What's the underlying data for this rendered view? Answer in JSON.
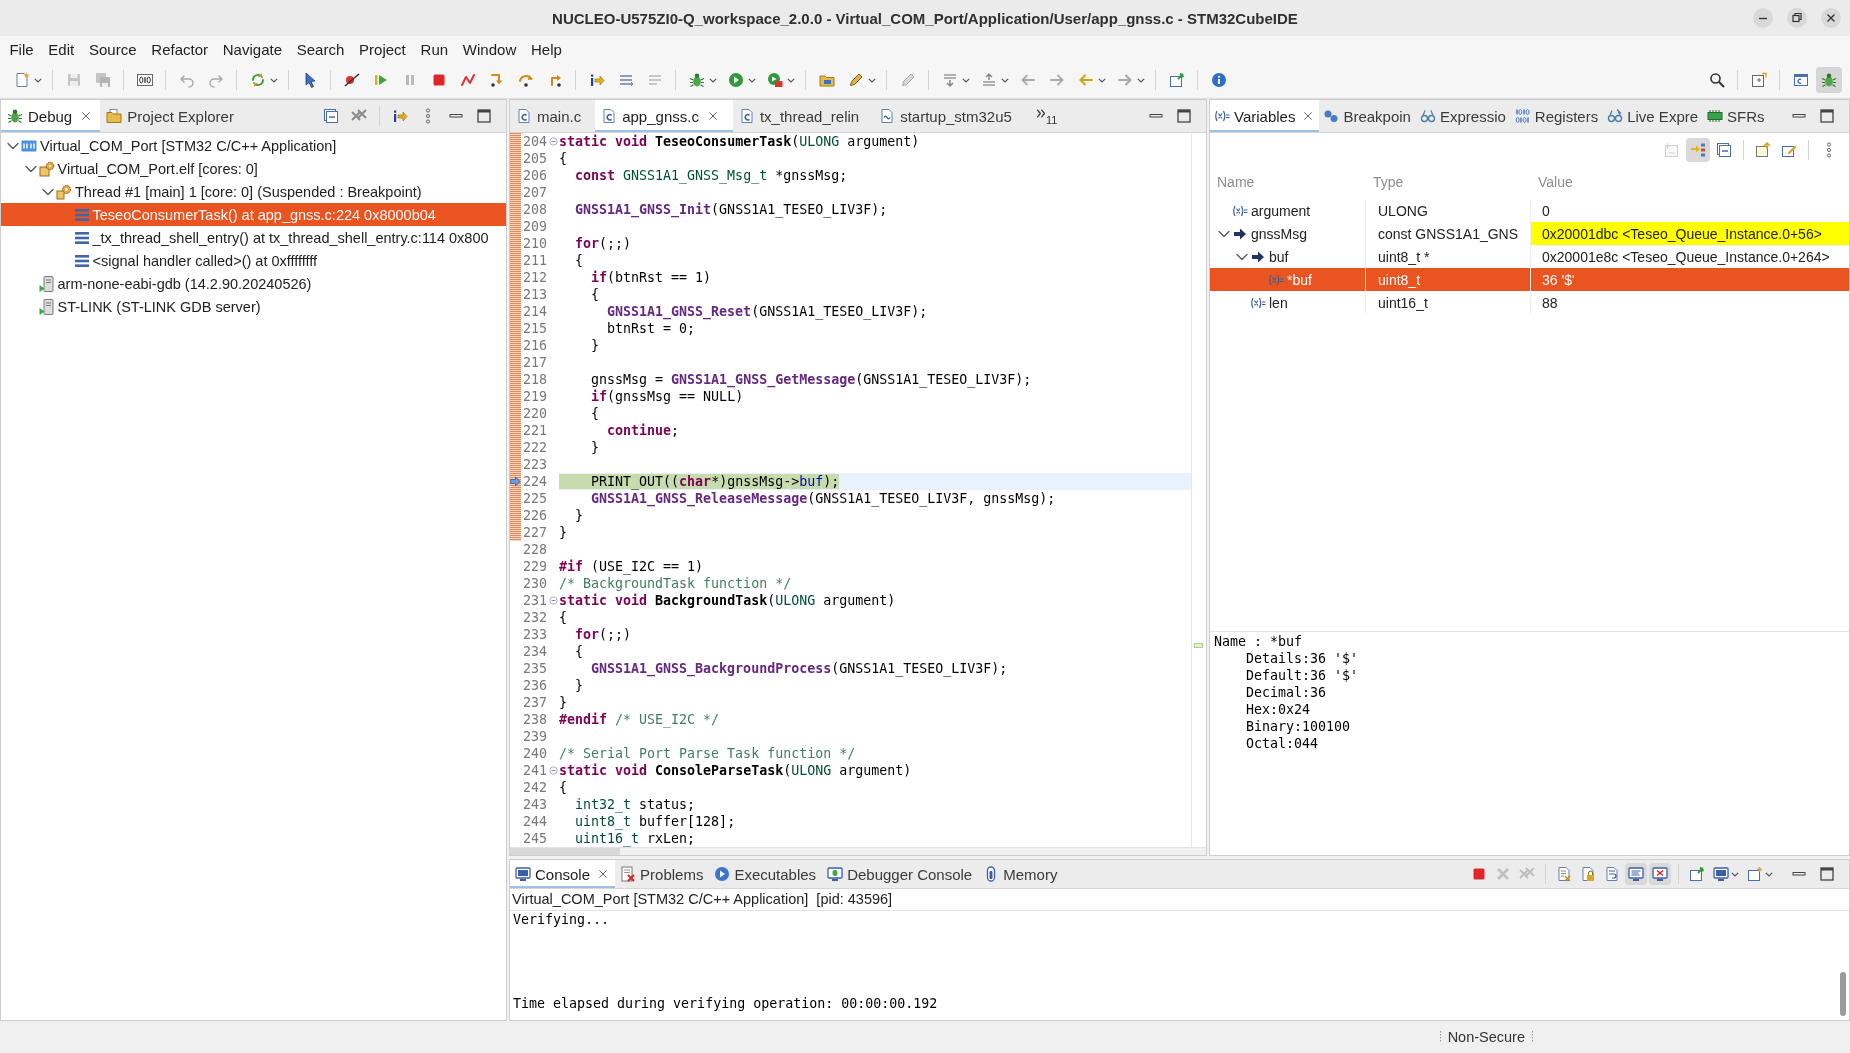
{
  "window": {
    "title": "NUCLEO-U575ZI0-Q_workspace_2.0.0 - Virtual_COM_Port/Application/User/app_gnss.c - STM32CubeIDE"
  },
  "menu": [
    "File",
    "Edit",
    "Source",
    "Refactor",
    "Navigate",
    "Search",
    "Project",
    "Run",
    "Window",
    "Help"
  ],
  "perspectives": [
    {
      "kind": "c-cpp",
      "selected": false
    },
    {
      "kind": "debug",
      "selected": true
    }
  ],
  "debug_view": {
    "tabs": [
      {
        "label": "Debug",
        "kind": "debug",
        "selected": true
      },
      {
        "label": "Project Explorer",
        "kind": "project",
        "selected": false
      }
    ],
    "tree": [
      {
        "label": "Virtual_COM_Port [STM32 C/C++ Application]",
        "kind": "launch",
        "expanded": true,
        "selected": false,
        "children": [
          {
            "label": "Virtual_COM_Port.elf [cores: 0]",
            "kind": "process",
            "expanded": true,
            "selected": false,
            "children": [
              {
                "label": "Thread #1 [main] 1 [core: 0] (Suspended : Breakpoint)",
                "kind": "thread",
                "expanded": true,
                "selected": false,
                "children": [
                  {
                    "label": "TeseoConsumerTask() at app_gnss.c:224 0x8000b04",
                    "kind": "frame",
                    "selected": true
                  },
                  {
                    "label": "_tx_thread_shell_entry() at tx_thread_shell_entry.c:114 0x800",
                    "kind": "frame",
                    "selected": false
                  },
                  {
                    "label": "<signal handler called>() at 0xffffffff",
                    "kind": "frame",
                    "selected": false
                  }
                ]
              }
            ]
          },
          {
            "label": "arm-none-eabi-gdb (14.2.90.20240526)",
            "kind": "debugger",
            "selected": false
          },
          {
            "label": "ST-LINK (ST-LINK GDB server)",
            "kind": "debugger",
            "selected": false
          }
        ]
      }
    ]
  },
  "editor": {
    "tabs": [
      {
        "label": "main.c",
        "kind": "c",
        "selected": false
      },
      {
        "label": "app_gnss.c",
        "kind": "c",
        "selected": true
      },
      {
        "label": "tx_thread_relin",
        "kind": "c",
        "selected": false
      },
      {
        "label": "startup_stm32u5",
        "kind": "asm",
        "selected": false
      }
    ],
    "hidden_tabs": "11",
    "sections": [
      {
        "in_range": true,
        "lines": [
          {
            "number": "204",
            "fold": true,
            "current": false,
            "code": [
              {
                "kind": "keyword",
                "text": "static void "
              },
              {
                "kind": "declaration",
                "text": "TeseoConsumerTask"
              },
              "(",
              {
                "kind": "type",
                "text": "ULONG"
              },
              " argument)"
            ]
          },
          {
            "number": "205",
            "fold": false,
            "current": false,
            "code": [
              "{"
            ]
          },
          {
            "number": "206",
            "fold": false,
            "current": false,
            "code": [
              {
                "kind": "keyword",
                "text": "  const "
              },
              {
                "kind": "type",
                "text": "GNSS1A1_GNSS_Msg_t"
              },
              " *gnssMsg;"
            ]
          },
          {
            "number": "207",
            "fold": false,
            "current": false
          },
          {
            "number": "208",
            "fold": false,
            "current": false,
            "code": [
              {
                "kind": "call",
                "text": "  GNSS1A1_GNSS_Init"
              },
              "(GNSS1A1_TESEO_LIV3F);"
            ]
          },
          {
            "number": "209",
            "fold": false,
            "current": false
          },
          {
            "number": "210",
            "fold": false,
            "current": false,
            "code": [
              {
                "kind": "keyword",
                "text": "  for"
              },
              "(;;)"
            ]
          },
          {
            "number": "211",
            "fold": false,
            "current": false,
            "code": [
              "  {"
            ]
          },
          {
            "number": "212",
            "fold": false,
            "current": false,
            "code": [
              {
                "kind": "keyword",
                "text": "    if"
              },
              "(btnRst == 1)"
            ]
          },
          {
            "number": "213",
            "fold": false,
            "current": false,
            "code": [
              "    {"
            ]
          },
          {
            "number": "214",
            "fold": false,
            "current": false,
            "code": [
              {
                "kind": "call",
                "text": "      GNSS1A1_GNSS_Reset"
              },
              "(GNSS1A1_TESEO_LIV3F);"
            ]
          },
          {
            "number": "215",
            "fold": false,
            "current": false,
            "code": [
              "      btnRst = 0;"
            ]
          },
          {
            "number": "216",
            "fold": false,
            "current": false,
            "code": [
              "    }"
            ]
          },
          {
            "number": "217",
            "fold": false,
            "current": false
          },
          {
            "number": "218",
            "fold": false,
            "current": false,
            "code": [
              "    gnssMsg = ",
              {
                "kind": "call",
                "text": "GNSS1A1_GNSS_GetMessage"
              },
              "(GNSS1A1_TESEO_LIV3F);"
            ]
          },
          {
            "number": "219",
            "fold": false,
            "current": false,
            "code": [
              {
                "kind": "keyword",
                "text": "    if"
              },
              "(gnssMsg == NULL)"
            ]
          },
          {
            "number": "220",
            "fold": false,
            "current": false,
            "code": [
              "    {"
            ]
          },
          {
            "number": "221",
            "fold": false,
            "current": false,
            "code": [
              {
                "kind": "keyword",
                "text": "      continue"
              },
              ";"
            ]
          },
          {
            "number": "222",
            "fold": false,
            "current": false,
            "code": [
              "    }"
            ]
          },
          {
            "number": "223",
            "fold": false,
            "current": false
          },
          {
            "number": "224",
            "fold": false,
            "current": true,
            "code": [
              "    PRINT_OUT((",
              {
                "kind": "keyword",
                "text": "char"
              },
              "*)gnssMsg->",
              {
                "kind": "field",
                "text": "buf"
              },
              ");"
            ]
          },
          {
            "number": "225",
            "fold": false,
            "current": false,
            "code": [
              {
                "kind": "call",
                "text": "    GNSS1A1_GNSS_ReleaseMessage"
              },
              "(GNSS1A1_TESEO_LIV3F, gnssMsg);"
            ]
          },
          {
            "number": "226",
            "fold": false,
            "current": false,
            "code": [
              "  }"
            ]
          },
          {
            "number": "227",
            "fold": false,
            "current": false,
            "code": [
              "}"
            ]
          }
        ]
      },
      {
        "in_range": false,
        "lines": [
          {
            "number": "228",
            "fold": false,
            "current": false
          },
          {
            "number": "229",
            "fold": false,
            "current": false,
            "code": [
              {
                "kind": "keyword",
                "text": "#if"
              },
              " (USE_I2C == 1)"
            ]
          },
          {
            "number": "230",
            "fold": false,
            "current": false,
            "code": [
              {
                "kind": "comment",
                "text": "/* BackgroundTask function */"
              }
            ]
          },
          {
            "number": "231",
            "fold": true,
            "current": false,
            "code": [
              {
                "kind": "keyword",
                "text": "static void "
              },
              {
                "kind": "declaration",
                "text": "BackgroundTask"
              },
              "(",
              {
                "kind": "type",
                "text": "ULONG"
              },
              " argument)"
            ]
          },
          {
            "number": "232",
            "fold": false,
            "current": false,
            "code": [
              "{"
            ]
          },
          {
            "number": "233",
            "fold": false,
            "current": false,
            "code": [
              {
                "kind": "keyword",
                "text": "  for"
              },
              "(;;)"
            ]
          },
          {
            "number": "234",
            "fold": false,
            "current": false,
            "code": [
              "  {"
            ]
          },
          {
            "number": "235",
            "fold": false,
            "current": false,
            "code": [
              {
                "kind": "call",
                "text": "    GNSS1A1_GNSS_BackgroundProcess"
              },
              "(GNSS1A1_TESEO_LIV3F);"
            ]
          },
          {
            "number": "236",
            "fold": false,
            "current": false,
            "code": [
              "  }"
            ]
          },
          {
            "number": "237",
            "fold": false,
            "current": false,
            "code": [
              "}"
            ]
          },
          {
            "number": "238",
            "fold": false,
            "current": false,
            "code": [
              {
                "kind": "keyword",
                "text": "#endif "
              },
              {
                "kind": "comment",
                "text": "/* USE_I2C */"
              }
            ]
          },
          {
            "number": "239",
            "fold": false,
            "current": false
          },
          {
            "number": "240",
            "fold": false,
            "current": false,
            "code": [
              {
                "kind": "comment",
                "text": "/* Serial Port Parse Task function */"
              }
            ]
          },
          {
            "number": "241",
            "fold": true,
            "current": false,
            "code": [
              {
                "kind": "keyword",
                "text": "static void "
              },
              {
                "kind": "declaration",
                "text": "ConsoleParseTask"
              },
              "(",
              {
                "kind": "type",
                "text": "ULONG"
              },
              " argument)"
            ]
          },
          {
            "number": "242",
            "fold": false,
            "current": false,
            "code": [
              "{"
            ]
          },
          {
            "number": "243",
            "fold": false,
            "current": false,
            "code": [
              {
                "kind": "type",
                "text": "  int32_t"
              },
              " status;"
            ]
          },
          {
            "number": "244",
            "fold": false,
            "current": false,
            "code": [
              {
                "kind": "type",
                "text": "  uint8_t"
              },
              " buffer[128];"
            ]
          },
          {
            "number": "245",
            "fold": false,
            "current": false,
            "code": [
              {
                "kind": "type",
                "text": "  uint16_t"
              },
              " rxLen;"
            ]
          }
        ]
      }
    ]
  },
  "variables": {
    "tabs": [
      {
        "label": "Variables",
        "kind": "variables",
        "selected": true
      },
      {
        "label": "Breakpoin",
        "kind": "breakpoints",
        "selected": false
      },
      {
        "label": "Expressio",
        "kind": "expressions",
        "selected": false
      },
      {
        "label": "Registers",
        "kind": "registers",
        "selected": false
      },
      {
        "label": "Live Expre",
        "kind": "live",
        "selected": false
      },
      {
        "label": "SFRs",
        "kind": "sfrs",
        "selected": false
      }
    ],
    "toolbar": [
      [
        {
          "kind": "type-names",
          "pressed": false,
          "disabled": true
        },
        {
          "kind": "logical-structure",
          "pressed": true,
          "disabled": false
        },
        {
          "kind": "collapse-all",
          "pressed": false,
          "disabled": false
        }
      ],
      [
        {
          "kind": "add-global",
          "pressed": false,
          "disabled": false
        },
        {
          "kind": "edit",
          "pressed": false,
          "disabled": false
        }
      ]
    ],
    "columns": [
      "Name",
      "Type",
      "Value"
    ],
    "rows": [
      {
        "name": "argument",
        "type": "ULONG",
        "value": "0",
        "kind": "variable",
        "selected": false,
        "changed": false
      },
      {
        "name": "gnssMsg",
        "type": "const GNSS1A1_GNS",
        "value": "0x20001dbc <Teseo_Queue_Instance.0+56>",
        "kind": "pointer",
        "expanded": true,
        "selected": false,
        "changed": true,
        "children": [
          {
            "name": "buf",
            "type": "uint8_t *",
            "value": "0x20001e8c <Teseo_Queue_Instance.0+264>",
            "kind": "pointer",
            "expanded": true,
            "selected": false,
            "changed": false,
            "children": [
              {
                "name": "*buf",
                "type": "uint8_t",
                "value": "36 '$'",
                "kind": "variable",
                "selected": true,
                "changed": false
              }
            ]
          },
          {
            "name": "len",
            "type": "uint16_t",
            "value": "88",
            "kind": "variable",
            "selected": false,
            "changed": false
          }
        ]
      }
    ],
    "details": {
      "heading": "Name : *buf",
      "lines": [
        "Details:36 '$'",
        "Default:36 '$'",
        "Decimal:36",
        "Hex:0x24",
        "Binary:100100",
        "Octal:044"
      ]
    }
  },
  "console": {
    "tabs": [
      {
        "label": "Console",
        "kind": "console",
        "selected": true
      },
      {
        "label": "Problems",
        "kind": "problems",
        "selected": false
      },
      {
        "label": "Executables",
        "kind": "executables",
        "selected": false
      },
      {
        "label": "Debugger Console",
        "kind": "debugger-console",
        "selected": false
      },
      {
        "label": "Memory",
        "kind": "memory",
        "selected": false
      }
    ],
    "toolbar": [
      [
        {
          "kind": "terminate",
          "pressed": false,
          "disabled": false
        },
        {
          "kind": "remove-launch",
          "pressed": false,
          "disabled": true
        },
        {
          "kind": "remove-all",
          "pressed": false,
          "disabled": true
        }
      ],
      [
        {
          "kind": "clear",
          "pressed": false,
          "disabled": false
        },
        {
          "kind": "scroll-lock",
          "pressed": false,
          "disabled": false
        },
        {
          "kind": "word-wrap",
          "pressed": false,
          "disabled": false
        },
        {
          "kind": "show-stdout",
          "pressed": true,
          "disabled": false
        },
        {
          "kind": "show-stderr",
          "pressed": true,
          "disabled": false
        }
      ],
      [
        {
          "kind": "pin",
          "pressed": false,
          "disabled": false
        },
        {
          "kind": "display-console",
          "pressed": false,
          "disabled": false
        },
        {
          "kind": "open-console",
          "pressed": false,
          "disabled": false
        }
      ]
    ],
    "process": "Virtual_COM_Port [STM32 C/C++ Application]  [pid: 43596]",
    "output": [
      "Verifying...",
      "Time elapsed during verifying operation: 00:00:00.192"
    ]
  },
  "status_bar": {
    "text": "Non-Secure"
  }
}
